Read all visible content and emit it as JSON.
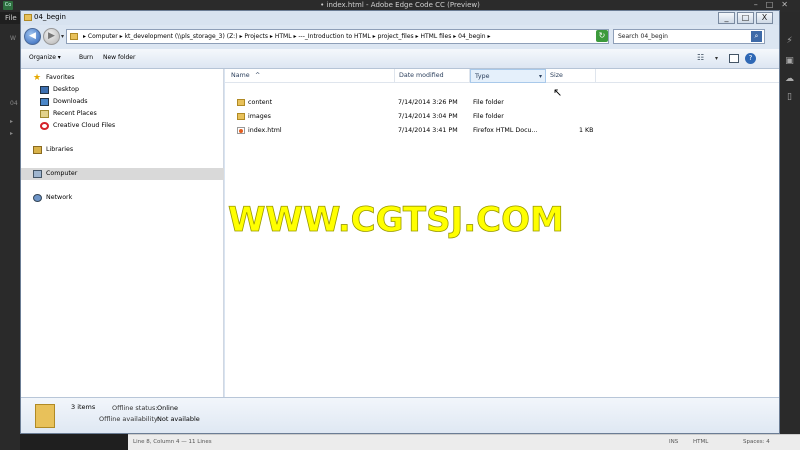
{
  "app": {
    "title": "• index.html - Adobe Edge Code CC (Preview)",
    "logo": "Co",
    "menu_first": "File",
    "left_fragments": [
      "W",
      "04",
      "▸",
      "▸"
    ],
    "status": {
      "position": "Line 8, Column 4 — 11 Lines",
      "ins": "INS",
      "language": "HTML",
      "spaces": "Spaces: 4"
    }
  },
  "explorer": {
    "title": "04_begin",
    "window_buttons": {
      "minimize": "_",
      "maximize": "□",
      "close": "X"
    },
    "nav": {
      "back": "◀",
      "forward": "▶",
      "recent": "▾"
    },
    "address": {
      "path": "▸ Computer ▸ kt_development (\\\\pls_storage_3) (Z:) ▸ Projects ▸ HTML ▸ ---_Introduction to HTML ▸ project_files ▸ HTML files ▸ 04_begin ▸",
      "dropdown": "▾",
      "refresh": "↻"
    },
    "search": {
      "placeholder": "Search 04_begin"
    },
    "toolbar": {
      "organize": "Organize ▾",
      "burn": "Burn",
      "new_folder": "New folder",
      "views": "☷",
      "views_arrow": "▾",
      "help": "?"
    },
    "nav_pane": {
      "favorites": {
        "label": "Favorites",
        "items": [
          "Desktop",
          "Downloads",
          "Recent Places",
          "Creative Cloud Files"
        ]
      },
      "libraries": "Libraries",
      "computer": "Computer",
      "network": "Network"
    },
    "columns": {
      "name": "Name",
      "name_sort": "^",
      "date": "Date modified",
      "type": "Type",
      "size": "Size"
    },
    "files": [
      {
        "name": "content",
        "date": "7/14/2014 3:26 PM",
        "type": "File folder",
        "size": ""
      },
      {
        "name": "images",
        "date": "7/14/2014 3:04 PM",
        "type": "File folder",
        "size": ""
      },
      {
        "name": "index.html",
        "date": "7/14/2014 3:41 PM",
        "type": "Firefox HTML Docu...",
        "size": "1 KB"
      }
    ],
    "details": {
      "count": "3 items",
      "offline_status_label": "Offline status:",
      "offline_status_value": "Online",
      "offline_avail_label": "Offline availability:",
      "offline_avail_value": "Not available"
    }
  },
  "watermark": "WWW.CGTSJ.COM",
  "colors": {
    "accent": "#2e63b8",
    "selected_row": "#d9d9d9",
    "watermark": "#ffff00"
  }
}
